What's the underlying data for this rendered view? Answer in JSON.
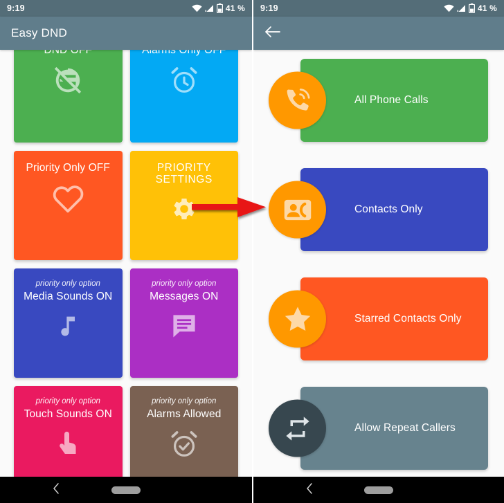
{
  "status_bar": {
    "time": "9:19",
    "battery_text": "41 %",
    "icons": [
      "wifi-icon",
      "cellular-signal-icon",
      "battery-icon"
    ]
  },
  "left_pane": {
    "app_bar": {
      "title": "Easy DND"
    },
    "tiles": [
      {
        "sub": "",
        "label": "DND OFF",
        "icon": "dnd-off-icon",
        "color": "#4caf50"
      },
      {
        "sub": "",
        "label": "Alarms Only OFF",
        "icon": "alarm-clock-icon",
        "color": "#03a9f4"
      },
      {
        "sub": "",
        "label": "Priority Only OFF",
        "icon": "heart-icon",
        "color": "#ff5722"
      },
      {
        "sub": "",
        "label": "PRIORITY SETTINGS",
        "icon": "gear-icon",
        "color": "#ffc107"
      },
      {
        "sub": "priority only option",
        "label": "Media Sounds ON",
        "icon": "music-note-icon",
        "color": "#3949c0"
      },
      {
        "sub": "priority only option",
        "label": "Messages ON",
        "icon": "message-icon",
        "color": "#ab2fc4"
      },
      {
        "sub": "priority only option",
        "label": "Touch Sounds ON",
        "icon": "touch-icon",
        "color": "#ea1a60"
      },
      {
        "sub": "priority only option",
        "label": "Alarms Allowed",
        "icon": "alarm-check-icon",
        "color": "#7a6152"
      }
    ]
  },
  "right_pane": {
    "app_bar": {
      "back_icon": "back-arrow-icon"
    },
    "options": [
      {
        "label": "All Phone Calls",
        "icon": "ringing-phone-icon",
        "card_color": "#4caf50",
        "badge_color": "#ff9800"
      },
      {
        "label": "Contacts Only",
        "icon": "contact-card-icon",
        "card_color": "#3949c0",
        "badge_color": "#ff9800"
      },
      {
        "label": "Starred Contacts Only",
        "icon": "star-icon",
        "card_color": "#ff5722",
        "badge_color": "#ff9800"
      },
      {
        "label": "Allow Repeat Callers",
        "icon": "repeat-icon",
        "card_color": "#67838e",
        "badge_color": "#37474f"
      }
    ]
  },
  "annotation": {
    "arrow": "red-right-arrow",
    "color": "#e81414"
  },
  "nav_bar": {
    "back_icon": "nav-back-chevron-icon",
    "home_icon": "nav-home-pill-icon"
  },
  "theme": {
    "app_bar_color": "#607d8b",
    "status_bar_color": "#546d78",
    "page_background": "#fafafa",
    "nav_bar_color": "#000000"
  }
}
